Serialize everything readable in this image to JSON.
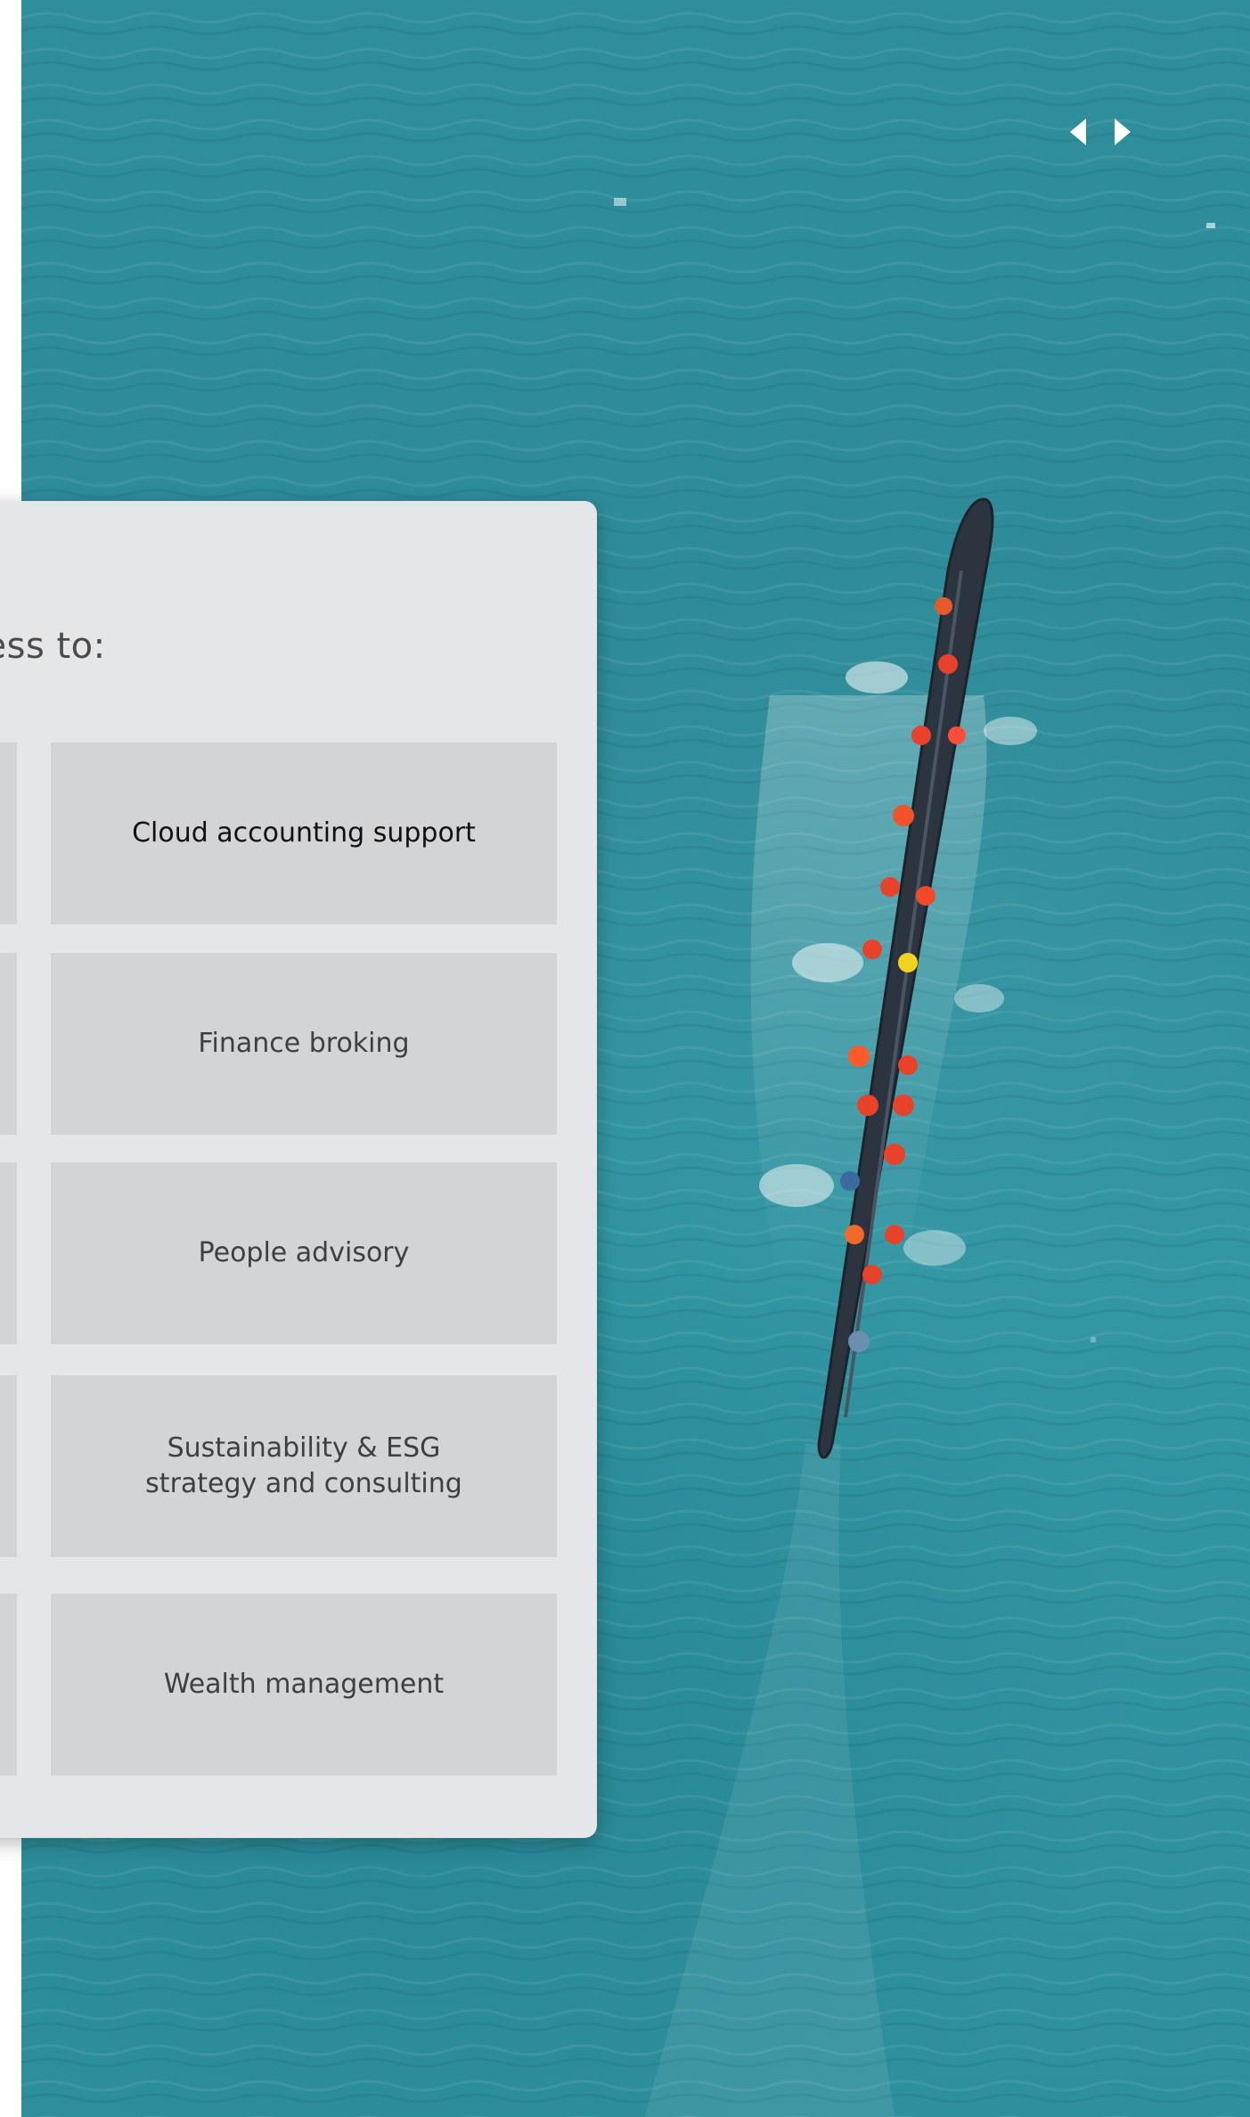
{
  "slider": {
    "prev_icon": "caret-left-icon",
    "next_icon": "caret-right-icon"
  },
  "card": {
    "heading": "cess to:",
    "services": [
      {
        "label": "Cloud accounting support"
      },
      {
        "label": "Finance broking"
      },
      {
        "label": "People advisory"
      },
      {
        "label": "Sustainability & ESG\nstrategy and consulting"
      },
      {
        "label": "Wealth management"
      }
    ]
  },
  "colors": {
    "card_bg": "#e5e6e7",
    "tile_bg": "#d2d4d6",
    "water": "#2f8e9c"
  }
}
